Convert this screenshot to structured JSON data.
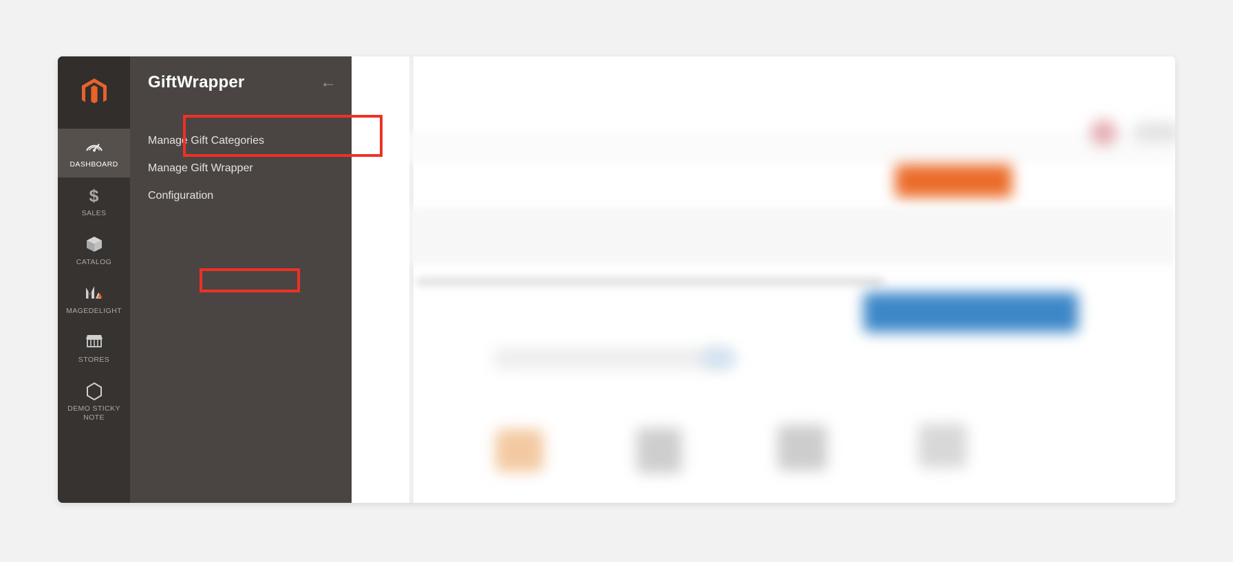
{
  "window": {
    "name": "magento-admin-panel"
  },
  "sidebar": {
    "logo_icon": "magento-logo-icon",
    "items": [
      {
        "label": "DASHBOARD",
        "icon": "gauge-icon",
        "active": true
      },
      {
        "label": "SALES",
        "icon": "dollar-icon",
        "active": false
      },
      {
        "label": "CATALOG",
        "icon": "box-icon",
        "active": false
      },
      {
        "label": "MAGEDELIGHT",
        "icon": "magedelight-icon",
        "active": false
      },
      {
        "label": "STORES",
        "icon": "storefront-icon",
        "active": false
      },
      {
        "label": "DEMO STICKY NOTE",
        "icon": "hexagon-icon",
        "active": false
      }
    ]
  },
  "submenu": {
    "title": "GiftWrapper",
    "back_icon": "arrow-left-icon",
    "items": [
      {
        "label": "Manage Gift Categories",
        "highlighted": false
      },
      {
        "label": "Manage Gift Wrapper",
        "highlighted": false
      },
      {
        "label": "Configuration",
        "highlighted": true
      }
    ]
  },
  "annotations": {
    "highlight_color": "#ee3124",
    "boxes": [
      {
        "target": "submenu-title",
        "label": "GiftWrapper"
      },
      {
        "target": "submenu-item-configuration",
        "label": "Configuration"
      }
    ]
  },
  "colors": {
    "rail_background": "#373330",
    "submenu_background": "#4a4542",
    "rail_active": "#55504c",
    "magento_orange": "#eb6c2a",
    "accent_blue": "#3d87c8",
    "page_background": "#f2f2f2"
  },
  "content": {
    "state": "blurred",
    "description": "obscured admin dashboard content"
  }
}
